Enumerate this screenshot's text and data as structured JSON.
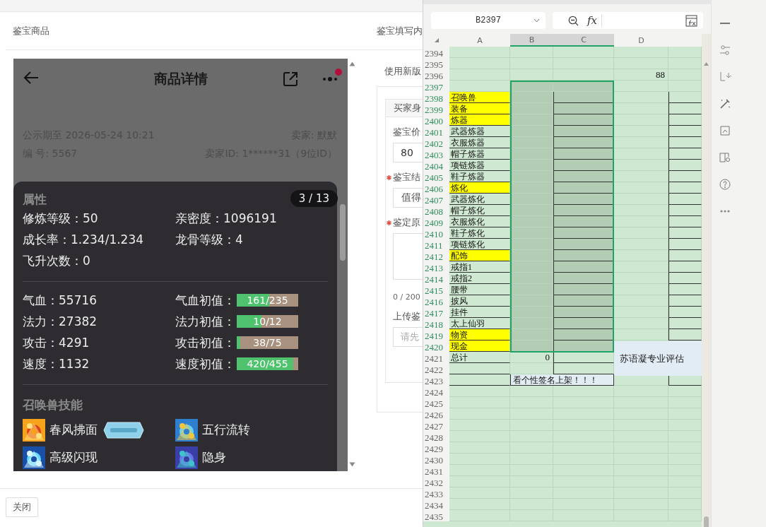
{
  "page": {
    "section_title": "鉴宝商品",
    "form_title": "鉴宝填写内",
    "close_button": "关闭"
  },
  "phone": {
    "title": "商品详情",
    "notice": true,
    "publicity": "公示期至 2026-05-24 10:21",
    "seller": "卖家: 默默",
    "number": "编 号: 5567",
    "seller_id": "卖家ID: 1******31（9位ID）"
  },
  "detail_sheet": {
    "counter": "3 / 13",
    "attributes_title": "属性",
    "attributes": [
      "修炼等级：50",
      "亲密度：1096191",
      "成长率：1.234/1.234",
      "龙骨等级：4",
      "飞升次数：0"
    ],
    "stats": [
      {
        "text": "气血：55716",
        "label": "气血初值：",
        "reading": "161/235",
        "level": 0.53
      },
      {
        "text": "法力：27382",
        "label": "法力初值：",
        "reading": "10/12",
        "level": 0.4
      },
      {
        "text": "攻击：4291",
        "label": "攻击初值：",
        "reading": "38/75",
        "level": 0.06
      },
      {
        "text": "速度：1132",
        "label": "速度初值：",
        "reading": "420/455",
        "level": 0.92
      }
    ],
    "skills_title": "召唤兽技能",
    "skills": [
      {
        "name": "春风拂面",
        "badge": true
      },
      {
        "name": "五行流转",
        "badge": false
      },
      {
        "name": "高级闪现",
        "badge": false
      },
      {
        "name": "隐身",
        "badge": false
      }
    ]
  },
  "form": {
    "switch_label": "使用新版",
    "tab": "买家身",
    "fields": [
      {
        "kind": "input",
        "label": "鉴宝价",
        "required": false,
        "value": "80"
      },
      {
        "kind": "select",
        "label": "鉴宝结",
        "required": true,
        "value": "值得"
      },
      {
        "kind": "textarea",
        "label": "鉴定原",
        "required": true,
        "count": "0 / 200"
      },
      {
        "kind": "upload",
        "label": "上传鉴",
        "required": false,
        "placeholder": "请先"
      }
    ]
  },
  "spreadsheet": {
    "name_box": "B2397",
    "formula_label": "fx",
    "columns": [
      {
        "label": "A",
        "selected": false
      },
      {
        "label": "B",
        "selected": true
      },
      {
        "label": "C",
        "selected": true
      },
      {
        "label": "D",
        "selected": false
      }
    ],
    "floating_box": "苏语凝专业评估",
    "rows": [
      {
        "number": "2394",
        "selected": false,
        "highlight": false,
        "bordered": false
      },
      {
        "number": "2395",
        "selected": false,
        "highlight": false,
        "bordered": false
      },
      {
        "number": "2396",
        "selected": false,
        "highlight": false,
        "bordered": false,
        "d": "88"
      },
      {
        "number": "2397",
        "selected": true,
        "highlight": false,
        "bordered": false
      },
      {
        "number": "2398",
        "selected": true,
        "highlight": true,
        "bordered": true,
        "label": "召唤兽"
      },
      {
        "number": "2399",
        "selected": true,
        "highlight": true,
        "bordered": true,
        "label": "装备"
      },
      {
        "number": "2400",
        "selected": true,
        "highlight": true,
        "bordered": true,
        "label": "炼器"
      },
      {
        "number": "2401",
        "selected": true,
        "highlight": false,
        "bordered": true,
        "label": "武器炼器"
      },
      {
        "number": "2402",
        "selected": true,
        "highlight": false,
        "bordered": true,
        "label": "衣服炼器"
      },
      {
        "number": "2403",
        "selected": true,
        "highlight": false,
        "bordered": true,
        "label": "帽子炼器"
      },
      {
        "number": "2404",
        "selected": true,
        "highlight": false,
        "bordered": true,
        "label": "项链炼器"
      },
      {
        "number": "2405",
        "selected": true,
        "highlight": false,
        "bordered": true,
        "label": "鞋子炼器"
      },
      {
        "number": "2406",
        "selected": true,
        "highlight": true,
        "bordered": true,
        "label": "炼化"
      },
      {
        "number": "2407",
        "selected": true,
        "highlight": false,
        "bordered": true,
        "label": "武器炼化"
      },
      {
        "number": "2408",
        "selected": true,
        "highlight": false,
        "bordered": true,
        "label": "帽子炼化"
      },
      {
        "number": "2409",
        "selected": true,
        "highlight": false,
        "bordered": true,
        "label": "衣服炼化"
      },
      {
        "number": "2410",
        "selected": true,
        "highlight": false,
        "bordered": true,
        "label": "鞋子炼化"
      },
      {
        "number": "2411",
        "selected": true,
        "highlight": false,
        "bordered": true,
        "label": "项链炼化"
      },
      {
        "number": "2412",
        "selected": true,
        "highlight": true,
        "bordered": true,
        "label": "配饰"
      },
      {
        "number": "2413",
        "selected": true,
        "highlight": false,
        "bordered": true,
        "label": "戒指1"
      },
      {
        "number": "2414",
        "selected": true,
        "highlight": false,
        "bordered": true,
        "label": "戒指2"
      },
      {
        "number": "2415",
        "selected": true,
        "highlight": false,
        "bordered": true,
        "label": "腰带"
      },
      {
        "number": "2416",
        "selected": true,
        "highlight": false,
        "bordered": true,
        "label": "披风"
      },
      {
        "number": "2417",
        "selected": true,
        "highlight": false,
        "bordered": true,
        "label": "挂件"
      },
      {
        "number": "2418",
        "selected": true,
        "highlight": false,
        "bordered": true,
        "label": "太上仙羽"
      },
      {
        "number": "2419",
        "selected": true,
        "highlight": true,
        "bordered": true,
        "label": "物资"
      },
      {
        "number": "2420",
        "selected": true,
        "highlight": true,
        "bordered": true,
        "label": "现金"
      },
      {
        "number": "2421",
        "selected": false,
        "highlight": false,
        "bordered": true,
        "label": "总计",
        "b": "0"
      },
      {
        "number": "2422",
        "selected": false,
        "highlight": false,
        "bordered": true
      },
      {
        "number": "2423",
        "selected": false,
        "highlight": false,
        "bordered": true,
        "note": "看个性签名上架！！！"
      },
      {
        "number": "2424",
        "selected": false,
        "highlight": false,
        "bordered": false
      },
      {
        "number": "2425",
        "selected": false,
        "highlight": false,
        "bordered": false
      },
      {
        "number": "2426",
        "selected": false,
        "highlight": false,
        "bordered": false
      },
      {
        "number": "2427",
        "selected": false,
        "highlight": false,
        "bordered": false
      },
      {
        "number": "2428",
        "selected": false,
        "highlight": false,
        "bordered": false
      },
      {
        "number": "2429",
        "selected": false,
        "highlight": false,
        "bordered": false
      },
      {
        "number": "2430",
        "selected": false,
        "highlight": false,
        "bordered": false
      },
      {
        "number": "2431",
        "selected": false,
        "highlight": false,
        "bordered": false
      },
      {
        "number": "2432",
        "selected": false,
        "highlight": false,
        "bordered": false
      },
      {
        "number": "2433",
        "selected": false,
        "highlight": false,
        "bordered": false
      },
      {
        "number": "2434",
        "selected": false,
        "highlight": false,
        "bordered": false
      },
      {
        "number": "2435",
        "selected": false,
        "highlight": false,
        "bordered": false
      }
    ]
  }
}
